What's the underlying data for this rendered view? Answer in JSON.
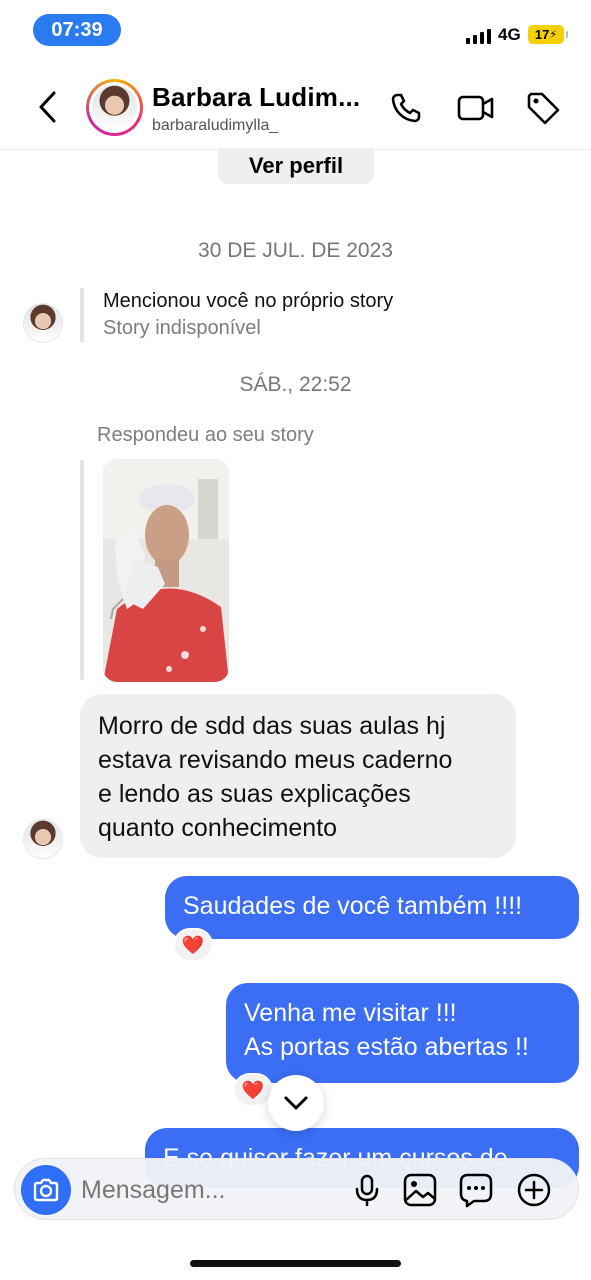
{
  "status_bar": {
    "time": "07:39",
    "network": "4G",
    "battery": "17"
  },
  "header": {
    "name": "Barbara Ludim...",
    "username": "barbaraludimylla_",
    "icons": [
      "back-arrow-icon",
      "phone-icon",
      "video-camera-icon",
      "tag-icon"
    ]
  },
  "profile_button": "Ver perfil",
  "dates": {
    "first": "30 DE JUL. DE 2023",
    "second": "SÁB., 22:52"
  },
  "mention": {
    "title": "Mencionou você no próprio story",
    "subtitle": "Story indisponível"
  },
  "story_reply": {
    "label": "Respondeu ao seu story"
  },
  "messages": {
    "incoming": [
      "Morro de sdd das suas aulas hj",
      "estava revisando meus caderno",
      "e lendo as suas explicações",
      "quanto conhecimento"
    ],
    "outgoing_1": "Saudades de você também !!!!",
    "outgoing_2": [
      "Venha me visitar !!!",
      "As portas estão abertas !!"
    ],
    "outgoing_3_partial": "E se quiser fazer um cursos de"
  },
  "reactions": {
    "heart": "❤️"
  },
  "composer": {
    "placeholder": "Mensagem...",
    "icons": [
      "camera-icon",
      "microphone-icon",
      "gallery-icon",
      "sticker-chat-icon",
      "plus-circle-icon"
    ]
  },
  "colors": {
    "accent": "#2f6ef6",
    "outgoing_bubble": "#3b6df5",
    "incoming_bubble": "#efefef",
    "time_pill": "#2a7bf0",
    "battery": "#f5d000"
  }
}
